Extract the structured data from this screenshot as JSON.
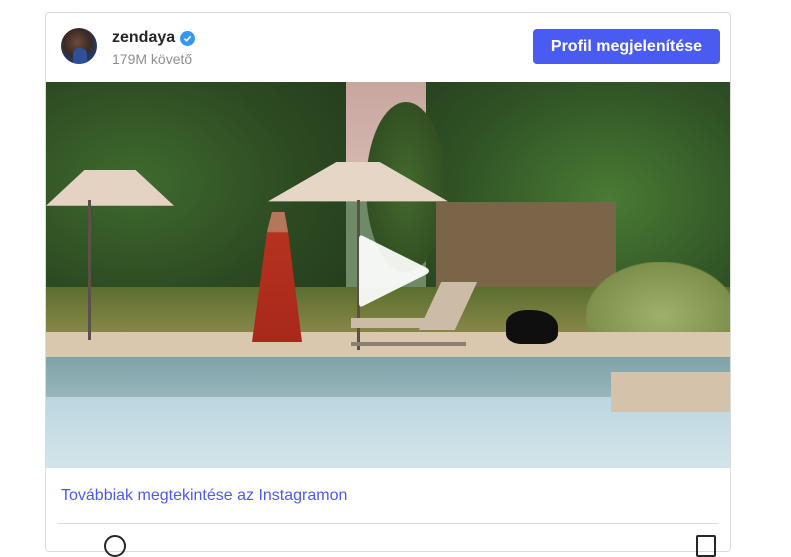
{
  "post": {
    "username": "zendaya",
    "followers": "179M követő",
    "verified_icon": "verified-badge-icon",
    "profile_button_label": "Profil megjelenítése",
    "media_type": "video",
    "more_link": "Továbbiak megtekintése az Instagramon"
  },
  "colors": {
    "accent": "#4a5bf1",
    "verified": "#3897f0",
    "muted": "#8e8e8e"
  }
}
